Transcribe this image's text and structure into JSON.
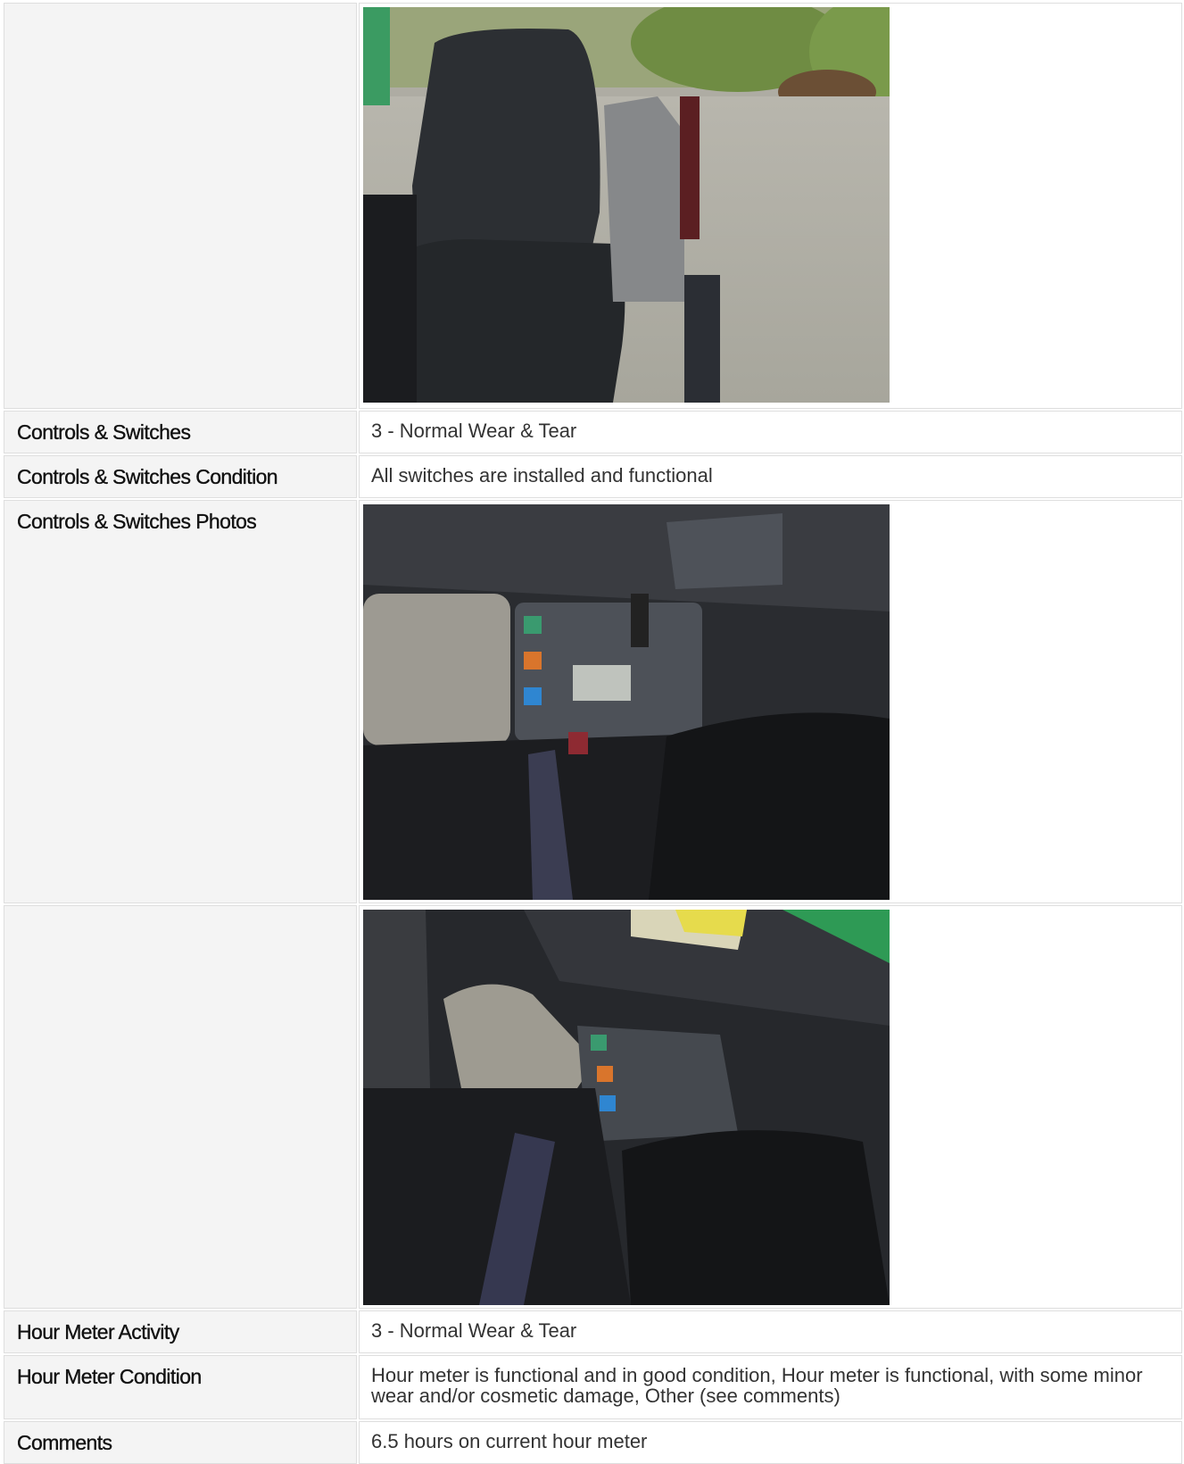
{
  "rows": [
    {
      "label": "",
      "photo": "seat-photo"
    },
    {
      "label": "Controls & Switches",
      "value": "3 - Normal Wear & Tear"
    },
    {
      "label": "Controls & Switches Condition",
      "value": "All switches are installed and functional"
    },
    {
      "label": "Controls & Switches Photos",
      "photo": "control-panel-photo-1"
    },
    {
      "label": "",
      "photo": "control-panel-photo-2"
    },
    {
      "label": "Hour Meter Activity",
      "value": "3 - Normal Wear & Tear"
    },
    {
      "label": "Hour Meter Condition",
      "value": "Hour meter is functional and in good condition, Hour meter is functional, with some minor wear and/or cosmetic damage, Other (see comments)"
    },
    {
      "label": "Comments",
      "value": "6.5 hours on current hour meter"
    }
  ]
}
